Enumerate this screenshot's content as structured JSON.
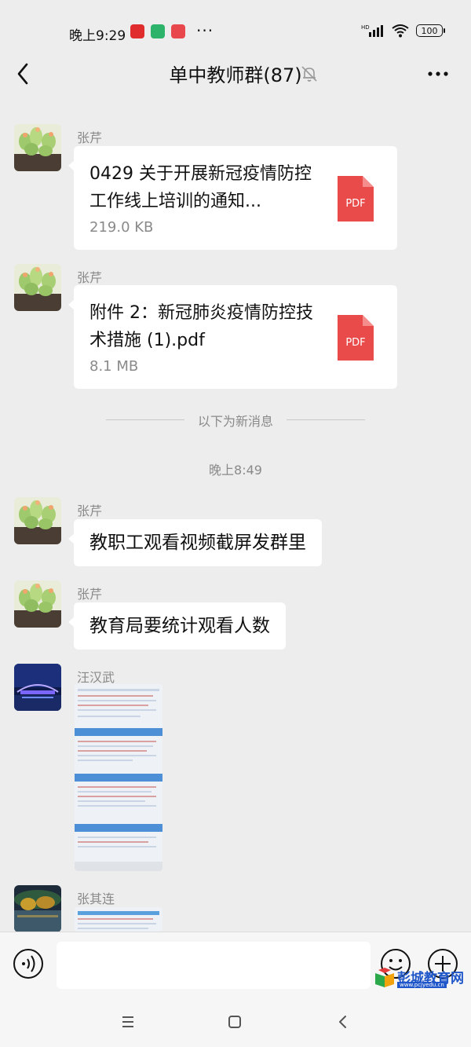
{
  "status_bar": {
    "time": "晚上9:29",
    "dots": "···",
    "network": "HD",
    "battery": "100"
  },
  "header": {
    "title": "单中教师群(87)"
  },
  "messages": [
    {
      "sender": "张芹",
      "type": "file",
      "file_name": "0429 关于开展新冠疫情防控工作线上培训的通知...",
      "file_size": "219.0 KB",
      "file_type": "PDF"
    },
    {
      "sender": "张芹",
      "type": "file",
      "file_name": "附件 2：新冠肺炎疫情防控技术措施 (1).pdf",
      "file_size": "8.1 MB",
      "file_type": "PDF"
    },
    {
      "sender": "张芹",
      "type": "text",
      "text": "教职工观看视频截屏发群里"
    },
    {
      "sender": "张芹",
      "type": "text",
      "text": "教育局要统计观看人数"
    },
    {
      "sender": "汪汉武",
      "type": "image"
    },
    {
      "sender": "张其连",
      "type": "image"
    }
  ],
  "divider": {
    "new_messages": "以下为新消息"
  },
  "timestamp": "晚上8:49",
  "watermark": {
    "name": "彭城教育网",
    "url": "www.pcjyedu.cn"
  },
  "colors": {
    "background": "#ededed",
    "bubble": "#ffffff",
    "pdf_red": "#e94b4b",
    "meta_gray": "#8a8a8a"
  }
}
